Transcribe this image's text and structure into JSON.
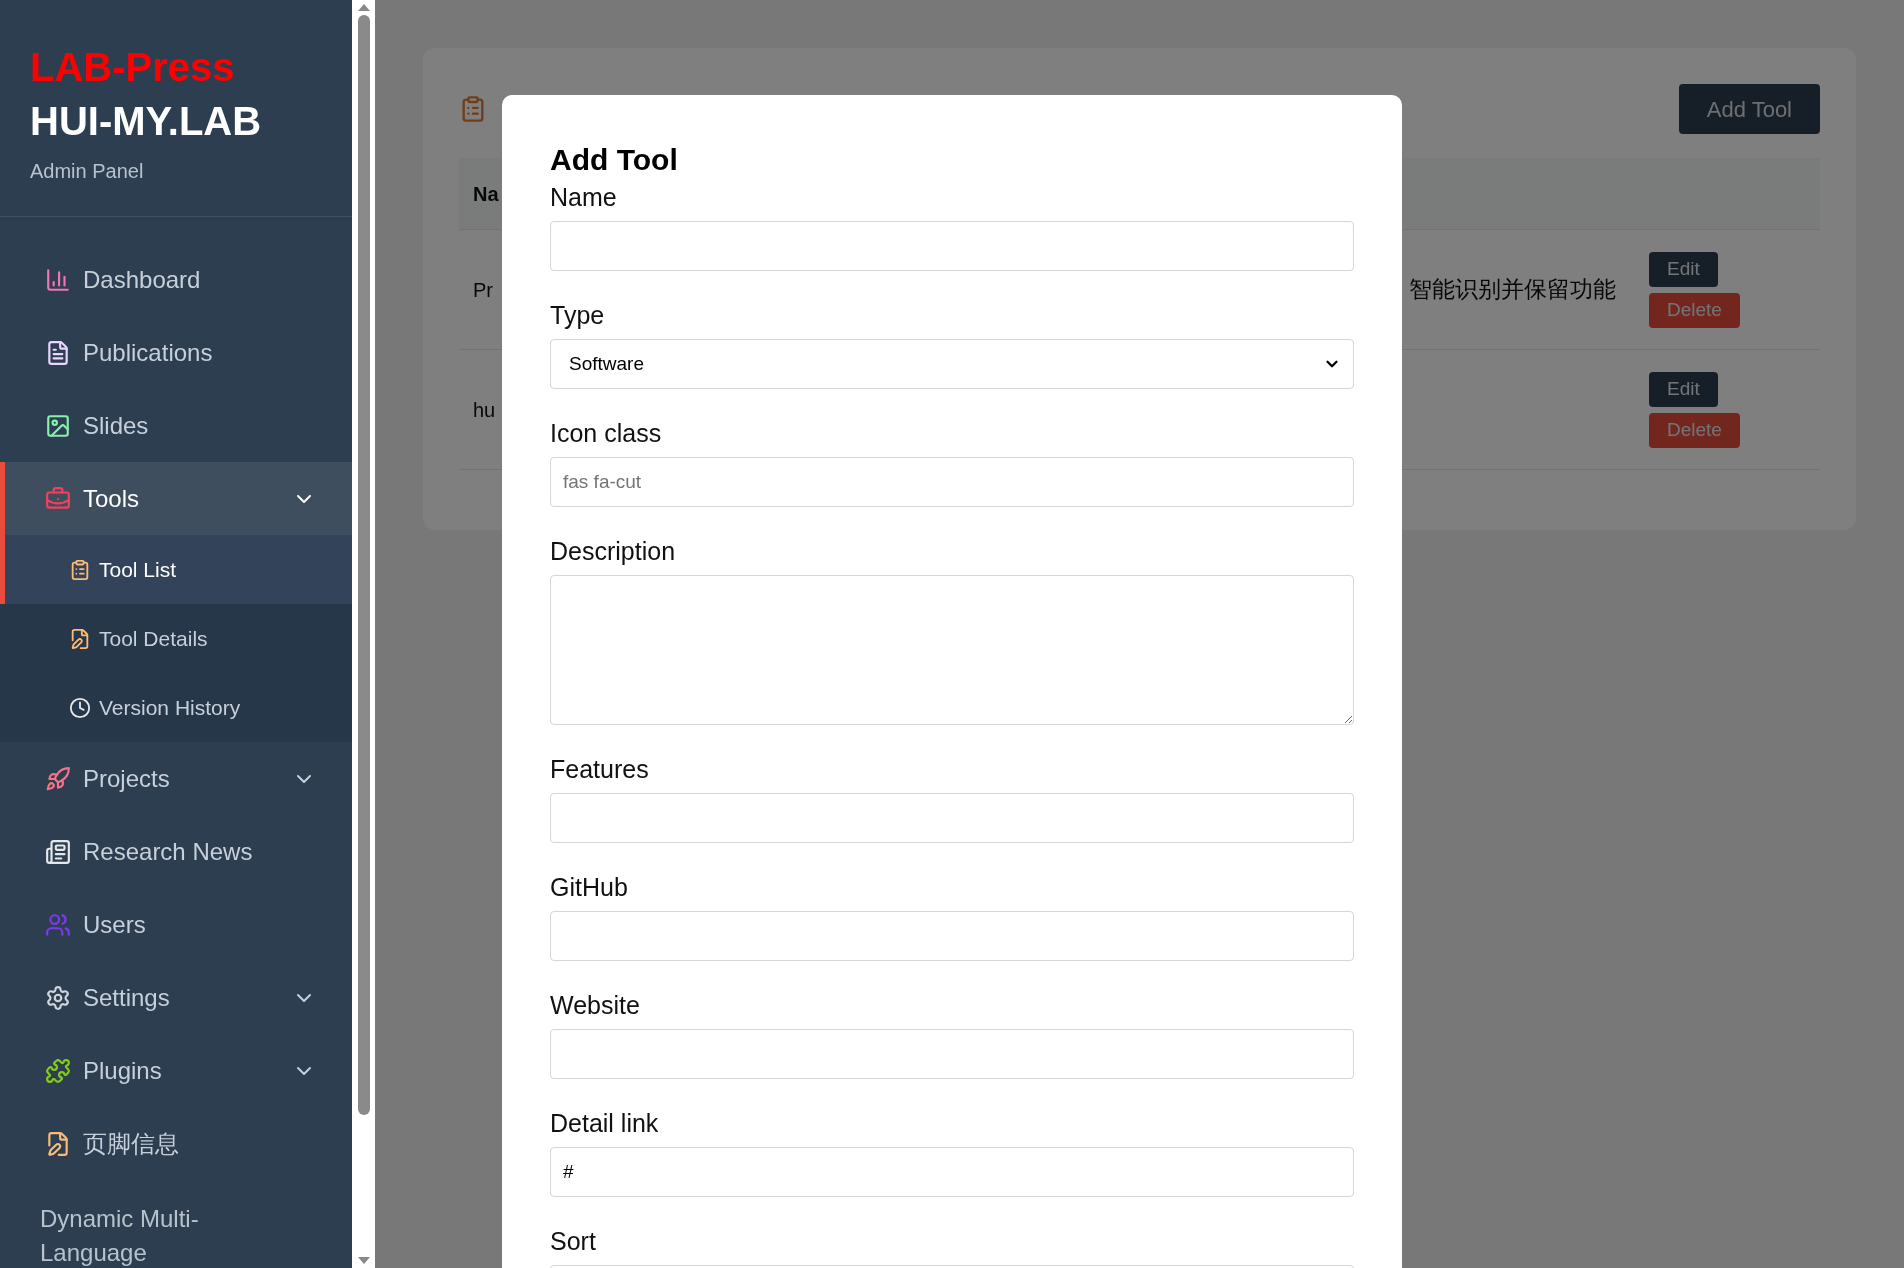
{
  "sidebar": {
    "brand": "LAB-Press",
    "title": "HUI-MY.LAB",
    "subtitle": "Admin Panel",
    "items": [
      {
        "kind": "item",
        "label": "Dashboard",
        "selected": false
      },
      {
        "kind": "item",
        "label": "Publications",
        "selected": false
      },
      {
        "kind": "item",
        "label": "Slides",
        "selected": false
      },
      {
        "kind": "item",
        "label": "Tools",
        "selected": true,
        "expanded": true,
        "children": [
          {
            "label": "Tool List",
            "selected": true
          },
          {
            "label": "Tool Details",
            "selected": false
          },
          {
            "label": "Version History",
            "selected": false
          }
        ]
      },
      {
        "kind": "item",
        "label": "Projects",
        "selected": false,
        "expanded": false
      },
      {
        "kind": "item",
        "label": "Research News",
        "selected": false
      },
      {
        "kind": "item",
        "label": "Users",
        "selected": false
      },
      {
        "kind": "item",
        "label": "Settings",
        "selected": false,
        "expanded": false
      },
      {
        "kind": "item",
        "label": "Plugins",
        "selected": false,
        "expanded": false
      },
      {
        "kind": "item",
        "label": "页脚信息",
        "selected": false
      },
      {
        "kind": "heading",
        "label": "Dynamic Multi-Language"
      }
    ]
  },
  "card": {
    "add_button": "Add Tool",
    "table": {
      "columns": [
        "Na"
      ],
      "rows": [
        {
          "cells": [
            "Pr",
            "智能识别并保留功能"
          ],
          "actions": [
            "Edit",
            "Delete"
          ]
        },
        {
          "cells": [
            "hu",
            ""
          ],
          "actions": [
            "Edit",
            "Delete"
          ]
        }
      ]
    }
  },
  "modal": {
    "title": "Add Tool",
    "fields": [
      {
        "label": "Name",
        "kind": "text"
      },
      {
        "label": "Type",
        "kind": "select",
        "value": "Software"
      },
      {
        "label": "Icon class",
        "kind": "text",
        "placeholder": "fas fa-cut"
      },
      {
        "label": "Description",
        "kind": "textarea"
      },
      {
        "label": "Features",
        "kind": "text"
      },
      {
        "label": "GitHub",
        "kind": "text"
      },
      {
        "label": "Website",
        "kind": "text"
      },
      {
        "label": "Detail link",
        "kind": "text",
        "value": "#"
      },
      {
        "label": "Sort",
        "kind": "text"
      }
    ]
  }
}
